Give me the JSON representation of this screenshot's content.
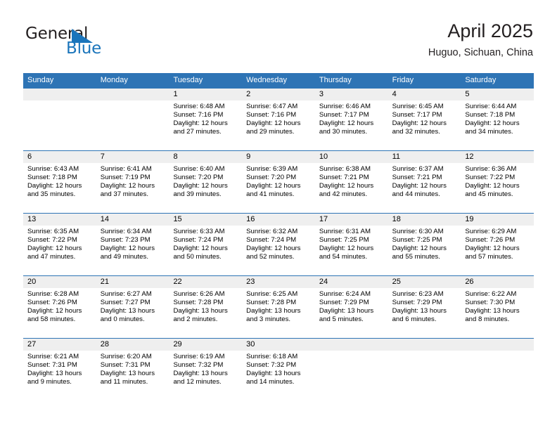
{
  "brand": {
    "name_part1": "General",
    "name_part2": "Blue",
    "flag_icon": "blue-triangle-flag",
    "accent_color": "#1b75bb"
  },
  "header": {
    "title": "April 2025",
    "subtitle": "Huguo, Sichuan, China"
  },
  "theme": {
    "header_blue": "#2e74b5",
    "daynum_band": "#efefef",
    "text": "#000000"
  },
  "weekdays": [
    "Sunday",
    "Monday",
    "Tuesday",
    "Wednesday",
    "Thursday",
    "Friday",
    "Saturday"
  ],
  "weeks": [
    [
      {
        "day": "",
        "sunrise": "",
        "sunset": "",
        "daylight_line1": "",
        "daylight_line2": ""
      },
      {
        "day": "",
        "sunrise": "",
        "sunset": "",
        "daylight_line1": "",
        "daylight_line2": ""
      },
      {
        "day": "1",
        "sunrise": "Sunrise: 6:48 AM",
        "sunset": "Sunset: 7:16 PM",
        "daylight_line1": "Daylight: 12 hours",
        "daylight_line2": "and 27 minutes."
      },
      {
        "day": "2",
        "sunrise": "Sunrise: 6:47 AM",
        "sunset": "Sunset: 7:16 PM",
        "daylight_line1": "Daylight: 12 hours",
        "daylight_line2": "and 29 minutes."
      },
      {
        "day": "3",
        "sunrise": "Sunrise: 6:46 AM",
        "sunset": "Sunset: 7:17 PM",
        "daylight_line1": "Daylight: 12 hours",
        "daylight_line2": "and 30 minutes."
      },
      {
        "day": "4",
        "sunrise": "Sunrise: 6:45 AM",
        "sunset": "Sunset: 7:17 PM",
        "daylight_line1": "Daylight: 12 hours",
        "daylight_line2": "and 32 minutes."
      },
      {
        "day": "5",
        "sunrise": "Sunrise: 6:44 AM",
        "sunset": "Sunset: 7:18 PM",
        "daylight_line1": "Daylight: 12 hours",
        "daylight_line2": "and 34 minutes."
      }
    ],
    [
      {
        "day": "6",
        "sunrise": "Sunrise: 6:43 AM",
        "sunset": "Sunset: 7:18 PM",
        "daylight_line1": "Daylight: 12 hours",
        "daylight_line2": "and 35 minutes."
      },
      {
        "day": "7",
        "sunrise": "Sunrise: 6:41 AM",
        "sunset": "Sunset: 7:19 PM",
        "daylight_line1": "Daylight: 12 hours",
        "daylight_line2": "and 37 minutes."
      },
      {
        "day": "8",
        "sunrise": "Sunrise: 6:40 AM",
        "sunset": "Sunset: 7:20 PM",
        "daylight_line1": "Daylight: 12 hours",
        "daylight_line2": "and 39 minutes."
      },
      {
        "day": "9",
        "sunrise": "Sunrise: 6:39 AM",
        "sunset": "Sunset: 7:20 PM",
        "daylight_line1": "Daylight: 12 hours",
        "daylight_line2": "and 41 minutes."
      },
      {
        "day": "10",
        "sunrise": "Sunrise: 6:38 AM",
        "sunset": "Sunset: 7:21 PM",
        "daylight_line1": "Daylight: 12 hours",
        "daylight_line2": "and 42 minutes."
      },
      {
        "day": "11",
        "sunrise": "Sunrise: 6:37 AM",
        "sunset": "Sunset: 7:21 PM",
        "daylight_line1": "Daylight: 12 hours",
        "daylight_line2": "and 44 minutes."
      },
      {
        "day": "12",
        "sunrise": "Sunrise: 6:36 AM",
        "sunset": "Sunset: 7:22 PM",
        "daylight_line1": "Daylight: 12 hours",
        "daylight_line2": "and 45 minutes."
      }
    ],
    [
      {
        "day": "13",
        "sunrise": "Sunrise: 6:35 AM",
        "sunset": "Sunset: 7:22 PM",
        "daylight_line1": "Daylight: 12 hours",
        "daylight_line2": "and 47 minutes."
      },
      {
        "day": "14",
        "sunrise": "Sunrise: 6:34 AM",
        "sunset": "Sunset: 7:23 PM",
        "daylight_line1": "Daylight: 12 hours",
        "daylight_line2": "and 49 minutes."
      },
      {
        "day": "15",
        "sunrise": "Sunrise: 6:33 AM",
        "sunset": "Sunset: 7:24 PM",
        "daylight_line1": "Daylight: 12 hours",
        "daylight_line2": "and 50 minutes."
      },
      {
        "day": "16",
        "sunrise": "Sunrise: 6:32 AM",
        "sunset": "Sunset: 7:24 PM",
        "daylight_line1": "Daylight: 12 hours",
        "daylight_line2": "and 52 minutes."
      },
      {
        "day": "17",
        "sunrise": "Sunrise: 6:31 AM",
        "sunset": "Sunset: 7:25 PM",
        "daylight_line1": "Daylight: 12 hours",
        "daylight_line2": "and 54 minutes."
      },
      {
        "day": "18",
        "sunrise": "Sunrise: 6:30 AM",
        "sunset": "Sunset: 7:25 PM",
        "daylight_line1": "Daylight: 12 hours",
        "daylight_line2": "and 55 minutes."
      },
      {
        "day": "19",
        "sunrise": "Sunrise: 6:29 AM",
        "sunset": "Sunset: 7:26 PM",
        "daylight_line1": "Daylight: 12 hours",
        "daylight_line2": "and 57 minutes."
      }
    ],
    [
      {
        "day": "20",
        "sunrise": "Sunrise: 6:28 AM",
        "sunset": "Sunset: 7:26 PM",
        "daylight_line1": "Daylight: 12 hours",
        "daylight_line2": "and 58 minutes."
      },
      {
        "day": "21",
        "sunrise": "Sunrise: 6:27 AM",
        "sunset": "Sunset: 7:27 PM",
        "daylight_line1": "Daylight: 13 hours",
        "daylight_line2": "and 0 minutes."
      },
      {
        "day": "22",
        "sunrise": "Sunrise: 6:26 AM",
        "sunset": "Sunset: 7:28 PM",
        "daylight_line1": "Daylight: 13 hours",
        "daylight_line2": "and 2 minutes."
      },
      {
        "day": "23",
        "sunrise": "Sunrise: 6:25 AM",
        "sunset": "Sunset: 7:28 PM",
        "daylight_line1": "Daylight: 13 hours",
        "daylight_line2": "and 3 minutes."
      },
      {
        "day": "24",
        "sunrise": "Sunrise: 6:24 AM",
        "sunset": "Sunset: 7:29 PM",
        "daylight_line1": "Daylight: 13 hours",
        "daylight_line2": "and 5 minutes."
      },
      {
        "day": "25",
        "sunrise": "Sunrise: 6:23 AM",
        "sunset": "Sunset: 7:29 PM",
        "daylight_line1": "Daylight: 13 hours",
        "daylight_line2": "and 6 minutes."
      },
      {
        "day": "26",
        "sunrise": "Sunrise: 6:22 AM",
        "sunset": "Sunset: 7:30 PM",
        "daylight_line1": "Daylight: 13 hours",
        "daylight_line2": "and 8 minutes."
      }
    ],
    [
      {
        "day": "27",
        "sunrise": "Sunrise: 6:21 AM",
        "sunset": "Sunset: 7:31 PM",
        "daylight_line1": "Daylight: 13 hours",
        "daylight_line2": "and 9 minutes."
      },
      {
        "day": "28",
        "sunrise": "Sunrise: 6:20 AM",
        "sunset": "Sunset: 7:31 PM",
        "daylight_line1": "Daylight: 13 hours",
        "daylight_line2": "and 11 minutes."
      },
      {
        "day": "29",
        "sunrise": "Sunrise: 6:19 AM",
        "sunset": "Sunset: 7:32 PM",
        "daylight_line1": "Daylight: 13 hours",
        "daylight_line2": "and 12 minutes."
      },
      {
        "day": "30",
        "sunrise": "Sunrise: 6:18 AM",
        "sunset": "Sunset: 7:32 PM",
        "daylight_line1": "Daylight: 13 hours",
        "daylight_line2": "and 14 minutes."
      },
      {
        "day": "",
        "sunrise": "",
        "sunset": "",
        "daylight_line1": "",
        "daylight_line2": ""
      },
      {
        "day": "",
        "sunrise": "",
        "sunset": "",
        "daylight_line1": "",
        "daylight_line2": ""
      },
      {
        "day": "",
        "sunrise": "",
        "sunset": "",
        "daylight_line1": "",
        "daylight_line2": ""
      }
    ]
  ]
}
